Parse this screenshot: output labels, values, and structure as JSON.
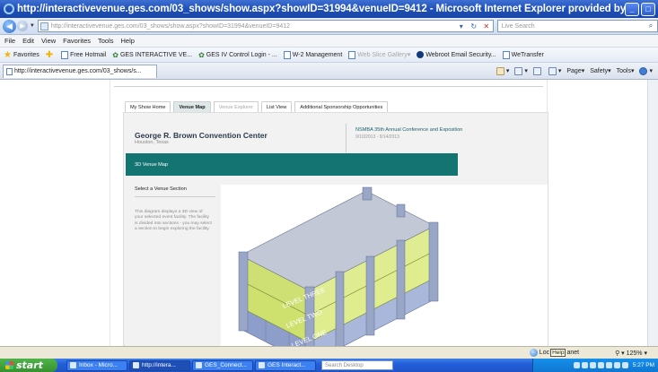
{
  "window": {
    "title": "http://interactivevenue.ges.com/03_shows/show.aspx?showID=31994&venueID=9412 - Microsoft Internet Explorer provided by Global E",
    "controls": [
      "_",
      "□"
    ]
  },
  "address": {
    "url": "http://interactivevenue.ges.com/03_shows/show.aspx?showID=31994&venueID=9412",
    "search_placeholder": "Live Search"
  },
  "menu": [
    "File",
    "Edit",
    "View",
    "Favorites",
    "Tools",
    "Help"
  ],
  "favorites_bar": {
    "label": "Favorites",
    "items": [
      {
        "label": "Free Hotmail",
        "dim": false
      },
      {
        "label": "GES INTERACTIVE VE...",
        "dim": false
      },
      {
        "label": "GES IV Control Login - ...",
        "dim": false
      },
      {
        "label": "W-2 Management",
        "dim": false
      },
      {
        "label": "Web Slice Gallery",
        "dim": true
      },
      {
        "label": "Webroot Email Security...",
        "dim": false
      },
      {
        "label": "WeTransfer",
        "dim": false
      }
    ]
  },
  "tab": {
    "label": "http://interactivevenue.ges.com/03_shows/s..."
  },
  "commands": {
    "page": "Page",
    "safety": "Safety",
    "tools": "Tools"
  },
  "page": {
    "tabs": [
      {
        "label": "My Show Home",
        "active": false,
        "dim": false
      },
      {
        "label": "Venue Map",
        "active": true,
        "dim": false
      },
      {
        "label": "Venue Explorer",
        "active": false,
        "dim": true
      },
      {
        "label": "List View",
        "active": false,
        "dim": false
      },
      {
        "label": "Additional Sponsorship Opportunities",
        "active": false,
        "dim": false
      }
    ],
    "venue_name": "George R. Brown Convention Center",
    "venue_location": "Houston, Texas",
    "event_name": "NSMBA 35th Annual Conference and Exposition",
    "event_dates": "9/10/2013 - 9/14/2013",
    "banner_title": "3D Venue Map",
    "section_heading": "Select a Venue Section",
    "description": "This diagram displays a 3D view of your selected event facility. The facility is divided into sections - you may select a section to begin exploring the facility.",
    "levels": [
      "LEVEL THREE",
      "LEVEL TWO",
      "LEVEL ONE"
    ]
  },
  "status": {
    "zone_prefix": "Loc",
    "tooltip": "Help",
    "zone_suffix": "anet",
    "zoom": "125%"
  },
  "taskbar": {
    "start": "start",
    "tasks": [
      {
        "label": "Inbox - Micro...",
        "active": false
      },
      {
        "label": "http://intera...",
        "active": true
      },
      {
        "label": "GES_Connect...",
        "active": false
      },
      {
        "label": "GES Interact...",
        "active": false
      }
    ],
    "search_placeholder": "Search Desktop",
    "clock": "5:27 PM"
  },
  "colors": {
    "banner": "#137471",
    "level_three": "#c9e05a",
    "level_two": "#c9e05a",
    "level_one": "#7c8fc1"
  }
}
